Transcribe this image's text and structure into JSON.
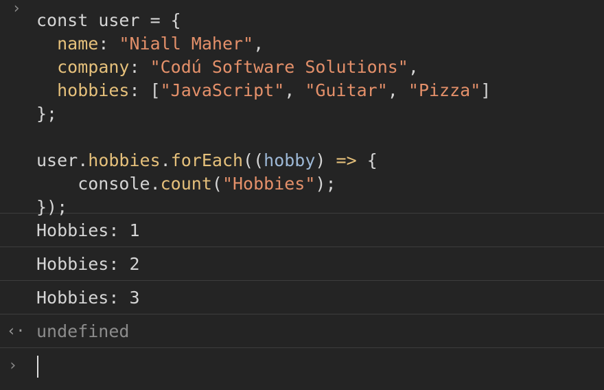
{
  "input": {
    "prompt_glyph": "›",
    "lines": [
      [
        {
          "t": "const ",
          "c": "kw"
        },
        {
          "t": "user",
          "c": "var"
        },
        {
          "t": " = {",
          "c": "punc"
        }
      ],
      [
        {
          "t": "  ",
          "c": "punc"
        },
        {
          "t": "name",
          "c": "prop"
        },
        {
          "t": ": ",
          "c": "punc"
        },
        {
          "t": "\"Niall Maher\"",
          "c": "str"
        },
        {
          "t": ",",
          "c": "punc"
        }
      ],
      [
        {
          "t": "  ",
          "c": "punc"
        },
        {
          "t": "company",
          "c": "prop"
        },
        {
          "t": ": ",
          "c": "punc"
        },
        {
          "t": "\"Codú Software Solutions\"",
          "c": "str"
        },
        {
          "t": ",",
          "c": "punc"
        }
      ],
      [
        {
          "t": "  ",
          "c": "punc"
        },
        {
          "t": "hobbies",
          "c": "prop"
        },
        {
          "t": ": [",
          "c": "punc"
        },
        {
          "t": "\"JavaScript\"",
          "c": "str"
        },
        {
          "t": ", ",
          "c": "punc"
        },
        {
          "t": "\"Guitar\"",
          "c": "str"
        },
        {
          "t": ", ",
          "c": "punc"
        },
        {
          "t": "\"Pizza\"",
          "c": "str"
        },
        {
          "t": "]",
          "c": "punc"
        }
      ],
      [
        {
          "t": "};",
          "c": "punc"
        }
      ],
      [
        {
          "t": "",
          "c": "punc"
        }
      ],
      [
        {
          "t": "user.",
          "c": "var"
        },
        {
          "t": "hobbies",
          "c": "method"
        },
        {
          "t": ".",
          "c": "punc"
        },
        {
          "t": "forEach",
          "c": "method"
        },
        {
          "t": "((",
          "c": "punc"
        },
        {
          "t": "hobby",
          "c": "param"
        },
        {
          "t": ") ",
          "c": "punc"
        },
        {
          "t": "=>",
          "c": "arrow"
        },
        {
          "t": " {",
          "c": "punc"
        }
      ],
      [
        {
          "t": "    console.",
          "c": "var"
        },
        {
          "t": "count",
          "c": "method"
        },
        {
          "t": "(",
          "c": "punc"
        },
        {
          "t": "\"Hobbies\"",
          "c": "str"
        },
        {
          "t": ");",
          "c": "punc"
        }
      ],
      [
        {
          "t": "});",
          "c": "punc"
        }
      ]
    ]
  },
  "logs": [
    "Hobbies: 1",
    "Hobbies: 2",
    "Hobbies: 3"
  ],
  "result": {
    "glyph": "‹·",
    "text": "undefined"
  },
  "prompt": {
    "glyph": "›"
  }
}
